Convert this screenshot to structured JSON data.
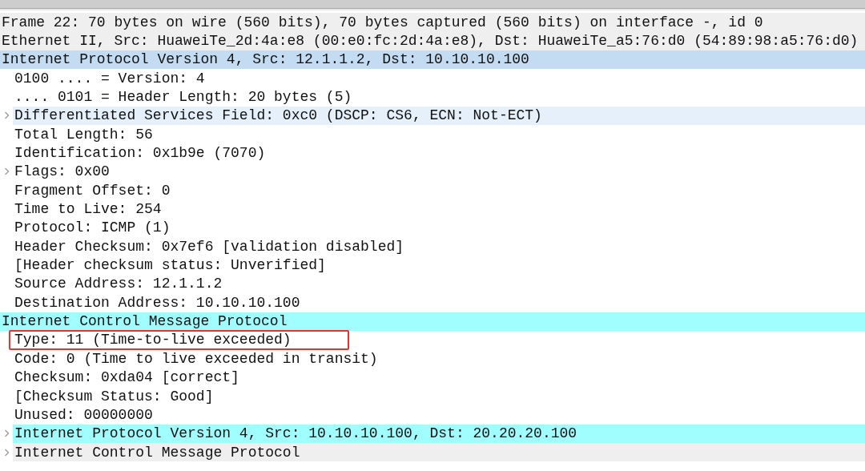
{
  "rows": [
    {
      "text": "Frame 22: 70 bytes on wire (560 bits), 70 bytes captured (560 bits) on interface -, id 0",
      "color": "#efefef"
    },
    {
      "text": "Ethernet II, Src: HuaweiTe_2d:4a:e8 (00:e0:fc:2d:4a:e8), Dst: HuaweiTe_a5:76:d0 (54:89:98:a5:76:d0)",
      "color": "#efefef"
    },
    {
      "text": "Internet Protocol Version 4, Src: 12.1.1.2, Dst: 10.10.10.100",
      "color": "#c3dcf2",
      "children": [
        {
          "text": "0100 .... = Version: 4"
        },
        {
          "text": ".... 0101 = Header Length: 20 bytes (5)"
        },
        {
          "text": "Differentiated Services Field: 0xc0 (DSCP: CS6, ECN: Not-ECT)",
          "color": "#e5f0fb",
          "expanded": false
        },
        {
          "text": "Total Length: 56"
        },
        {
          "text": "Identification: 0x1b9e (7070)"
        },
        {
          "text": "Flags: 0x00",
          "expanded": false
        },
        {
          "text": "Fragment Offset: 0"
        },
        {
          "text": "Time to Live: 254"
        },
        {
          "text": "Protocol: ICMP (1)"
        },
        {
          "text": "Header Checksum: 0x7ef6 [validation disabled]"
        },
        {
          "text": "[Header checksum status: Unverified]"
        },
        {
          "text": "Source Address: 12.1.1.2"
        },
        {
          "text": "Destination Address: 10.10.10.100"
        }
      ]
    },
    {
      "text": "Internet Control Message Protocol",
      "color": "#a0fffe",
      "children": [
        {
          "text": "Type: 11 (Time-to-live exceeded)",
          "highlighted": true
        },
        {
          "text": "Code: 0 (Time to live exceeded in transit)"
        },
        {
          "text": "Checksum: 0xda04 [correct]"
        },
        {
          "text": "[Checksum Status: Good]"
        },
        {
          "text": "Unused: 00000000"
        },
        {
          "text": "Internet Protocol Version 4, Src: 10.10.10.100, Dst: 20.20.20.100",
          "color": "#a0fffe",
          "expanded": false
        },
        {
          "text": "Internet Control Message Protocol",
          "color": "#efefef",
          "expanded": false
        }
      ]
    }
  ]
}
